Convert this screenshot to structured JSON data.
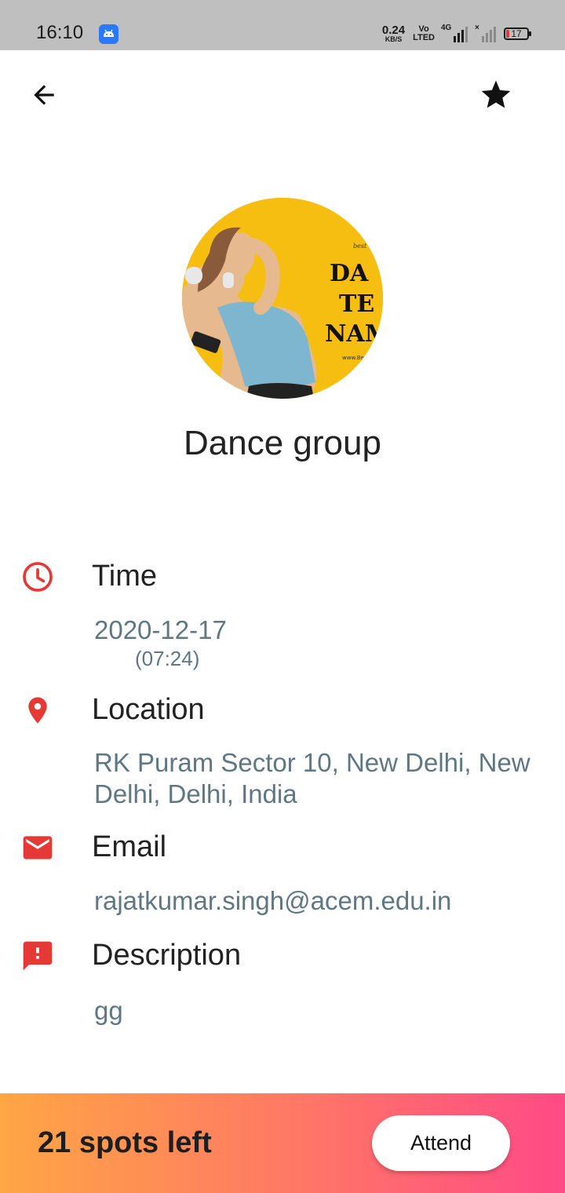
{
  "status_bar": {
    "time": "16:10",
    "net_speed_value": "0.24",
    "net_speed_unit": "KB/S",
    "volte_top": "Vo",
    "volte_bottom": "LTED",
    "network_type": "4G",
    "battery_level": "17"
  },
  "header": {
    "back_icon": "arrow-back-icon",
    "favorite_icon": "star-icon"
  },
  "event": {
    "title": "Dance group",
    "image_text": [
      "DA",
      "TE",
      "NAM",
      "best",
      "www.Be"
    ]
  },
  "details": {
    "time": {
      "icon": "clock-icon",
      "label": "Time",
      "date": "2020-12-17",
      "clock": "(07:24)"
    },
    "location": {
      "icon": "location-pin-icon",
      "label": "Location",
      "line1": "RK Puram Sector 10, New Delhi, New",
      "line2": "Delhi, Delhi, India"
    },
    "email": {
      "icon": "mail-icon",
      "label": "Email",
      "value": "rajatkumar.singh@acem.edu.in"
    },
    "description": {
      "icon": "feedback-icon",
      "label": "Description",
      "value": "gg"
    }
  },
  "footer": {
    "spots_left": "21 spots left",
    "attend_label": "Attend"
  },
  "colors": {
    "accent_red": "#e53935",
    "value_text": "#5f7783",
    "gradient_start": "#ffa645",
    "gradient_end": "#ff4a86"
  }
}
